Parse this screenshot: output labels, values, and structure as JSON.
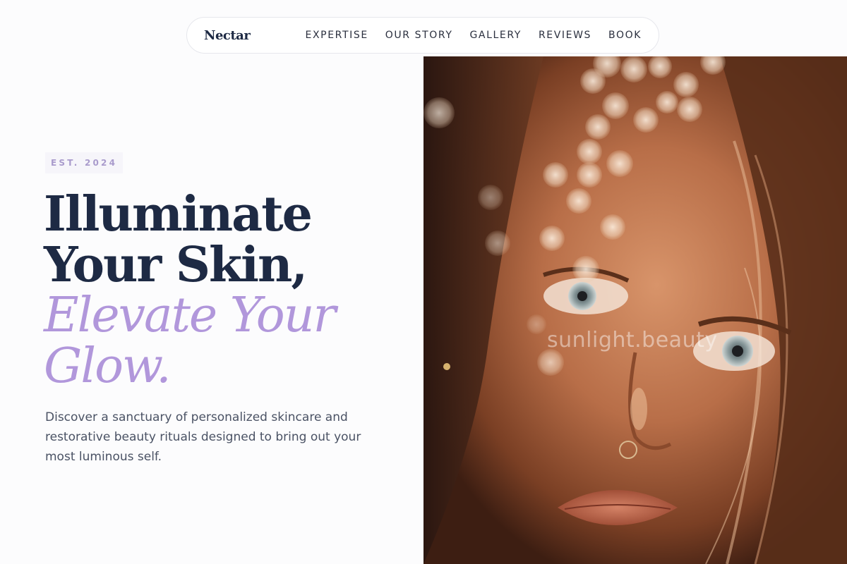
{
  "nav": {
    "brand": "Nectar",
    "links": [
      "EXPERTISE",
      "OUR STORY",
      "GALLERY",
      "REVIEWS",
      "BOOK"
    ]
  },
  "hero": {
    "badge": "EST. 2024",
    "headline_line1": "Illuminate",
    "headline_line2": "Your Skin,",
    "headline_accent1": "Elevate Your",
    "headline_accent2": "Glow.",
    "description": "Discover a sanctuary of personalized skincare and restorative beauty rituals designed to bring out your most luminous self.",
    "watermark": "sunlight.beauty"
  },
  "colors": {
    "heading": "#1e2a44",
    "accent": "#b197db",
    "body_text": "#4a5264",
    "page_bg": "#fcfcfd"
  }
}
